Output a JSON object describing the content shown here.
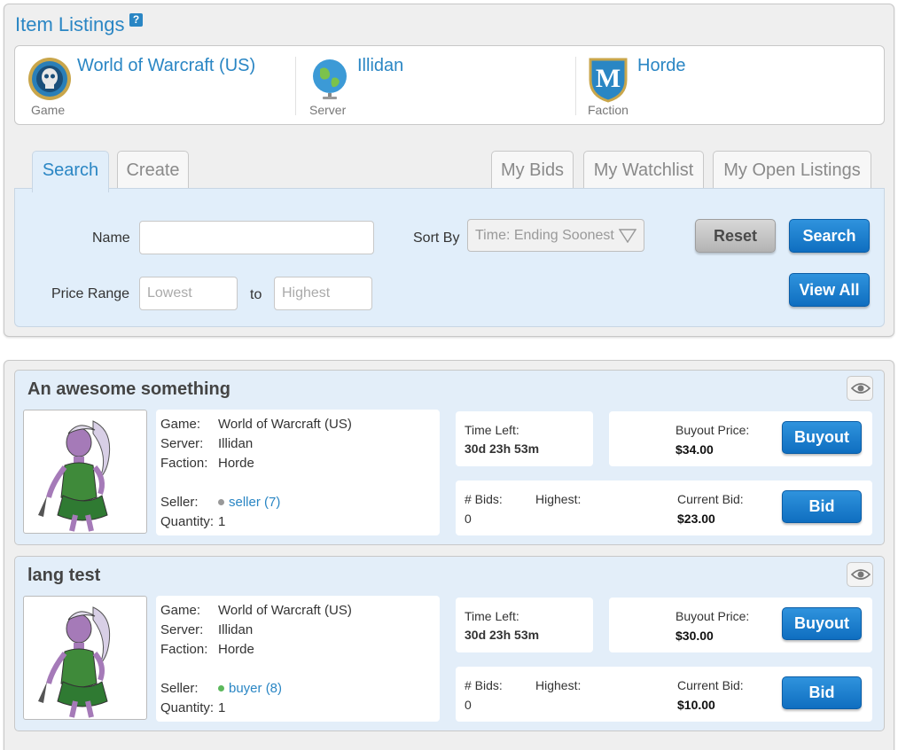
{
  "header": {
    "title": "Item Listings",
    "help": "?"
  },
  "context": {
    "game": {
      "value": "World of Warcraft (US)",
      "label": "Game",
      "icon": "wow-logo-icon"
    },
    "server": {
      "value": "Illidan",
      "label": "Server",
      "icon": "globe-icon"
    },
    "faction": {
      "value": "Horde",
      "label": "Faction",
      "icon": "m-shield-icon"
    }
  },
  "tabs": {
    "search": "Search",
    "create": "Create",
    "my_bids": "My Bids",
    "my_watchlist": "My Watchlist",
    "my_open_listings": "My Open Listings"
  },
  "search": {
    "name_label": "Name",
    "name_value": "",
    "sort_label": "Sort By",
    "sort_value": "Time: Ending Soonest",
    "price_label": "Price Range",
    "lowest_placeholder": "Lowest",
    "to_label": "to",
    "highest_placeholder": "Highest",
    "reset": "Reset",
    "search": "Search",
    "view_all": "View All"
  },
  "listing_labels": {
    "game": "Game:",
    "server": "Server:",
    "faction": "Faction:",
    "seller": "Seller:",
    "quantity": "Quantity:",
    "time_left": "Time Left:",
    "buyout_price": "Buyout Price:",
    "bids": "# Bids:",
    "highest": "Highest:",
    "current_bid": "Current Bid:",
    "buyout_btn": "Buyout",
    "bid_btn": "Bid"
  },
  "listings": [
    {
      "title": "An awesome something",
      "game": "World of Warcraft (US)",
      "server": "Illidan",
      "faction": "Horde",
      "seller": "seller (7)",
      "seller_status_color": "#999999",
      "quantity": "1",
      "time_left": "30d 23h 53m",
      "buyout_price": "$34.00",
      "bids": "0",
      "highest": "",
      "current_bid": "$23.00"
    },
    {
      "title": "lang test",
      "game": "World of Warcraft (US)",
      "server": "Illidan",
      "faction": "Horde",
      "seller": "buyer (8)",
      "seller_status_color": "#5cb85c",
      "quantity": "1",
      "time_left": "30d 23h 53m",
      "buyout_price": "$30.00",
      "bids": "0",
      "highest": "",
      "current_bid": "$10.00"
    }
  ]
}
